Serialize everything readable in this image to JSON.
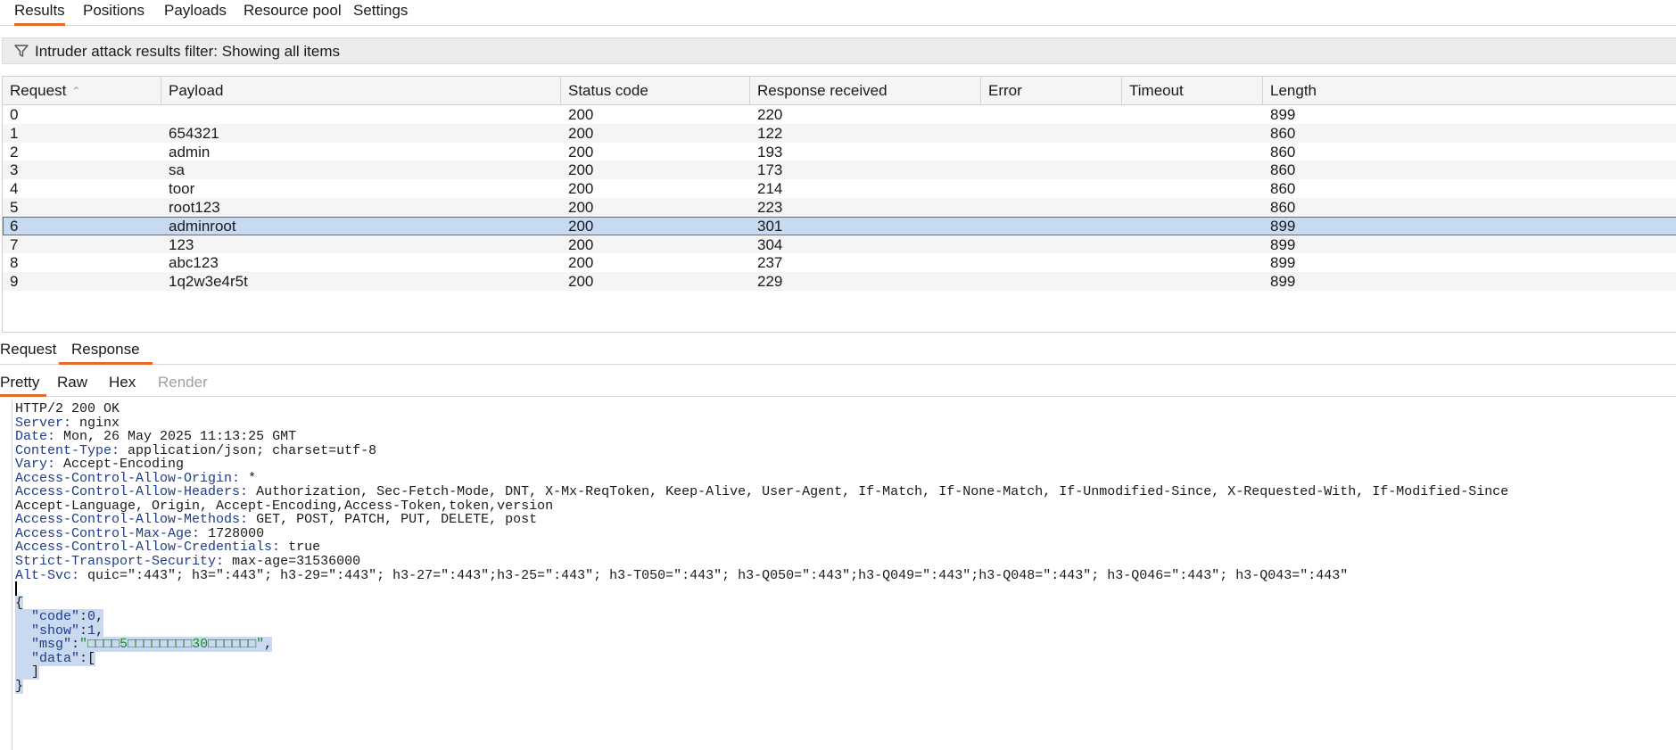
{
  "top_tabs": [
    {
      "label": "Results",
      "active": true
    },
    {
      "label": "Positions",
      "active": false
    },
    {
      "label": "Payloads",
      "active": false
    },
    {
      "label": "Resource pool",
      "active": false
    },
    {
      "label": "Settings",
      "active": false
    }
  ],
  "filter": {
    "text": "Intruder attack results filter: Showing all items",
    "icon": "filter-icon"
  },
  "table": {
    "columns": [
      "Request",
      "Payload",
      "Status code",
      "Response received",
      "Error",
      "Timeout",
      "Length"
    ],
    "sort_column": "Request",
    "rows": [
      {
        "request": "0",
        "payload": "",
        "status": "200",
        "received": "220",
        "error": "",
        "timeout": "",
        "length": "899"
      },
      {
        "request": "1",
        "payload": "654321",
        "status": "200",
        "received": "122",
        "error": "",
        "timeout": "",
        "length": "860"
      },
      {
        "request": "2",
        "payload": "admin",
        "status": "200",
        "received": "193",
        "error": "",
        "timeout": "",
        "length": "860"
      },
      {
        "request": "3",
        "payload": "sa",
        "status": "200",
        "received": "173",
        "error": "",
        "timeout": "",
        "length": "860"
      },
      {
        "request": "4",
        "payload": "toor",
        "status": "200",
        "received": "214",
        "error": "",
        "timeout": "",
        "length": "860"
      },
      {
        "request": "5",
        "payload": "root123",
        "status": "200",
        "received": "223",
        "error": "",
        "timeout": "",
        "length": "860"
      },
      {
        "request": "6",
        "payload": "adminroot",
        "status": "200",
        "received": "301",
        "error": "",
        "timeout": "",
        "length": "899",
        "selected": true
      },
      {
        "request": "7",
        "payload": "123",
        "status": "200",
        "received": "304",
        "error": "",
        "timeout": "",
        "length": "899"
      },
      {
        "request": "8",
        "payload": "abc123",
        "status": "200",
        "received": "237",
        "error": "",
        "timeout": "",
        "length": "899"
      },
      {
        "request": "9",
        "payload": "1q2w3e4r5t",
        "status": "200",
        "received": "229",
        "error": "",
        "timeout": "",
        "length": "899"
      }
    ]
  },
  "rr_tabs": [
    {
      "label": "Request",
      "active": false
    },
    {
      "label": "Response",
      "active": true
    }
  ],
  "view_tabs": [
    {
      "label": "Pretty",
      "active": true,
      "disabled": false
    },
    {
      "label": "Raw",
      "active": false,
      "disabled": false
    },
    {
      "label": "Hex",
      "active": false,
      "disabled": false
    },
    {
      "label": "Render",
      "active": false,
      "disabled": true
    }
  ],
  "response": {
    "status_line": "HTTP/2 200 OK",
    "headers": [
      {
        "name": "Server",
        "value": " nginx"
      },
      {
        "name": "Date",
        "value": " Mon, 26 May 2025 11:13:25 GMT"
      },
      {
        "name": "Content-Type",
        "value": " application/json; charset=utf-8"
      },
      {
        "name": "Vary",
        "value": " Accept-Encoding"
      },
      {
        "name": "Access-Control-Allow-Origin",
        "value": " *"
      },
      {
        "name": "Access-Control-Allow-Headers",
        "value": " Authorization, Sec-Fetch-Mode, DNT, X-Mx-ReqToken, Keep-Alive, User-Agent, If-Match, If-None-Match, If-Unmodified-Since, X-Requested-With, If-Modified-Since"
      },
      {
        "name": "",
        "value": "Accept-Language, Origin, Accept-Encoding,Access-Token,token,version"
      },
      {
        "name": "Access-Control-Allow-Methods",
        "value": " GET, POST, PATCH, PUT, DELETE, post"
      },
      {
        "name": "Access-Control-Max-Age",
        "value": " 1728000"
      },
      {
        "name": "Access-Control-Allow-Credentials",
        "value": " true"
      },
      {
        "name": "Strict-Transport-Security",
        "value": " max-age=31536000"
      },
      {
        "name": "Alt-Svc",
        "value": " quic=\":443\"; h3=\":443\"; h3-29=\":443\"; h3-27=\":443\";h3-25=\":443\"; h3-T050=\":443\"; h3-Q050=\":443\";h3-Q049=\":443\";h3-Q048=\":443\"; h3-Q046=\":443\"; h3-Q043=\":443\""
      }
    ],
    "json": {
      "open_brace": "{",
      "code_key": "\"code\"",
      "code_val": "0",
      "show_key": "\"show\"",
      "show_val": "1",
      "msg_key": "\"msg\"",
      "msg_val": "\"□□□□5□□□□□□□□30□□□□□□\"",
      "data_key": "\"data\"",
      "data_open": "[",
      "data_close": "]",
      "close_brace": "}"
    }
  }
}
